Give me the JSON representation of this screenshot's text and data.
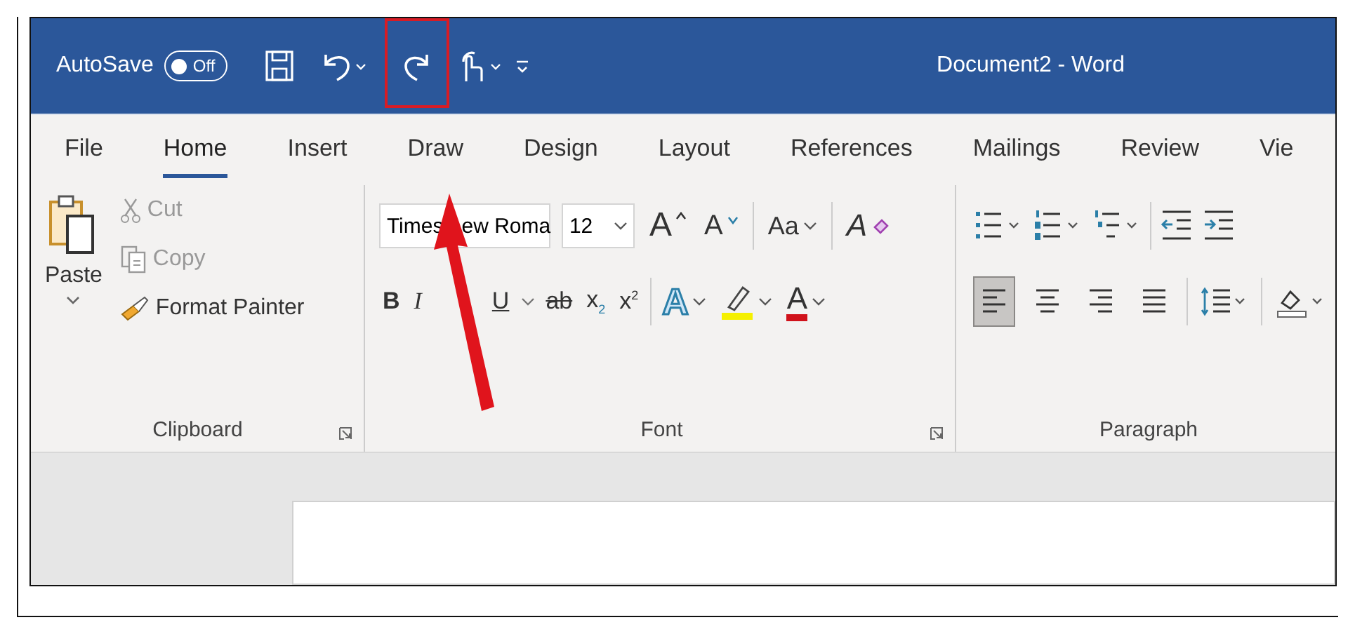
{
  "title_bar": {
    "autosave_label": "AutoSave",
    "autosave_toggle": {
      "label": "Off",
      "on": false
    },
    "title": "Document2 - Word"
  },
  "tabs": [
    {
      "label": "File",
      "selected": false
    },
    {
      "label": "Home",
      "selected": true
    },
    {
      "label": "Insert",
      "selected": false
    },
    {
      "label": "Draw",
      "selected": false
    },
    {
      "label": "Design",
      "selected": false
    },
    {
      "label": "Layout",
      "selected": false
    },
    {
      "label": "References",
      "selected": false
    },
    {
      "label": "Mailings",
      "selected": false
    },
    {
      "label": "Review",
      "selected": false
    },
    {
      "label": "Vie",
      "selected": false
    }
  ],
  "clipboard": {
    "paste": "Paste",
    "cut": "Cut",
    "copy": "Copy",
    "format_painter": "Format Painter",
    "label": "Clipboard"
  },
  "font": {
    "font_name_parts": [
      "Times",
      "ew Roma"
    ],
    "font_size": "12",
    "grow_font": "A",
    "shrink_font": "A",
    "change_case": "Aa",
    "clear_formatting": "A",
    "label": "Font",
    "format_buttons": [
      {
        "kind": "bold",
        "label": "B"
      },
      {
        "kind": "italic",
        "label": "I"
      },
      {
        "kind": "underline",
        "label": "U"
      },
      {
        "kind": "strikethrough",
        "label": "ab"
      },
      {
        "kind": "subscript",
        "label": "x",
        "mark": "2"
      },
      {
        "kind": "superscript",
        "label": "x",
        "mark": "2"
      }
    ],
    "text_effects": "A",
    "font_color": "A"
  },
  "paragraph": {
    "label": "Paragraph",
    "alignments": [
      {
        "kind": "left",
        "selected": true
      },
      {
        "kind": "center",
        "selected": false
      },
      {
        "kind": "right",
        "selected": false
      },
      {
        "kind": "justify",
        "selected": false
      }
    ]
  }
}
